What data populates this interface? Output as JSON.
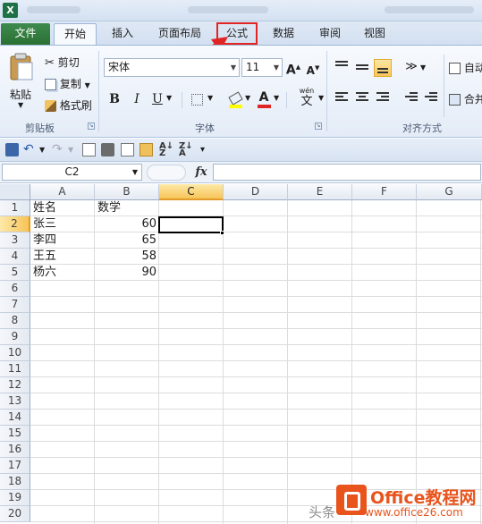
{
  "ribbon_tabs": {
    "file": "文件",
    "home": "开始",
    "insert": "插入",
    "page_layout": "页面布局",
    "formulas": "公式",
    "data": "数据",
    "review": "审阅",
    "view": "视图"
  },
  "clipboard": {
    "paste": "粘贴",
    "cut": "剪切",
    "copy": "复制",
    "format_painter": "格式刷",
    "group_label": "剪贴板"
  },
  "font": {
    "name": "宋体",
    "size": "11",
    "bold": "B",
    "italic": "I",
    "underline": "U",
    "wen": "wén",
    "wen_char": "文",
    "group_label": "字体"
  },
  "alignment": {
    "wrap_text": "自动",
    "merge": "合并",
    "group_label": "对齐方式"
  },
  "formula_bar": {
    "name_box": "C2",
    "fx": "fx",
    "value": ""
  },
  "sheet": {
    "columns": [
      "A",
      "B",
      "C",
      "D",
      "E",
      "F",
      "G"
    ],
    "rows": [
      "1",
      "2",
      "3",
      "4",
      "5",
      "6",
      "7",
      "8",
      "9",
      "10",
      "11",
      "12",
      "13",
      "14",
      "15",
      "16",
      "17",
      "18",
      "19",
      "20"
    ],
    "header_row": {
      "a": "姓名",
      "b": "数学"
    },
    "data": [
      {
        "a": "张三",
        "b": "60"
      },
      {
        "a": "李四",
        "b": "65"
      },
      {
        "a": "王五",
        "b": "58"
      },
      {
        "a": "杨六",
        "b": "90"
      }
    ],
    "active_cell": "C2"
  },
  "watermark": {
    "brand": "Office教程网",
    "url": "www.office26.com",
    "toutiao": "头条"
  },
  "colors": {
    "accent_red": "#e02525",
    "file_tab": "#2b7033",
    "selection": "#f7c457",
    "watermark": "#e8541c"
  }
}
